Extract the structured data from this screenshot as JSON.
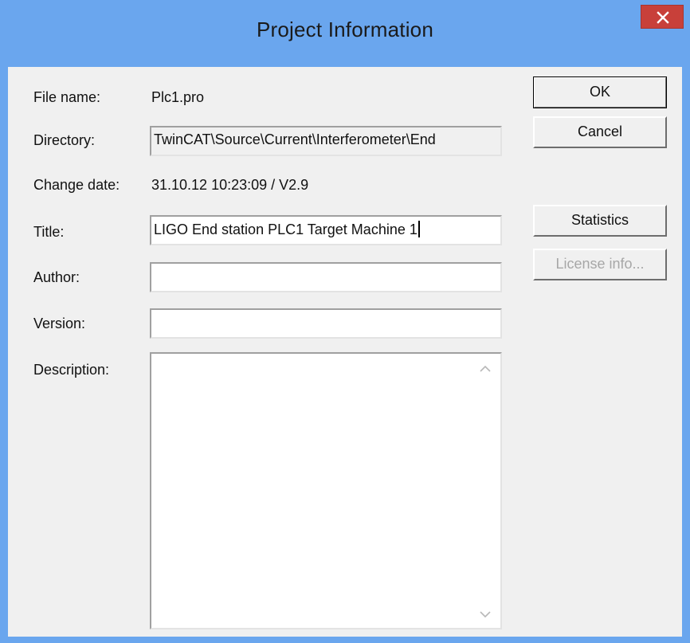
{
  "window": {
    "title": "Project Information"
  },
  "fields": {
    "file_name_label": "File name:",
    "file_name_value": "Plc1.pro",
    "directory_label": "Directory:",
    "directory_value": "TwinCAT\\Source\\Current\\Interferometer\\End",
    "change_date_label": "Change date:",
    "change_date_value": "31.10.12 10:23:09 / V2.9",
    "title_label": "Title:",
    "title_value": "LIGO End station PLC1 Target Machine 1",
    "author_label": "Author:",
    "author_value": "",
    "version_label": "Version:",
    "version_value": "",
    "description_label": "Description:",
    "description_value": ""
  },
  "buttons": {
    "ok": "OK",
    "cancel": "Cancel",
    "statistics": "Statistics",
    "license_info": "License info..."
  },
  "icons": {
    "close": "close-icon",
    "scroll_up": "chevron-up-icon",
    "scroll_down": "chevron-down-icon"
  }
}
